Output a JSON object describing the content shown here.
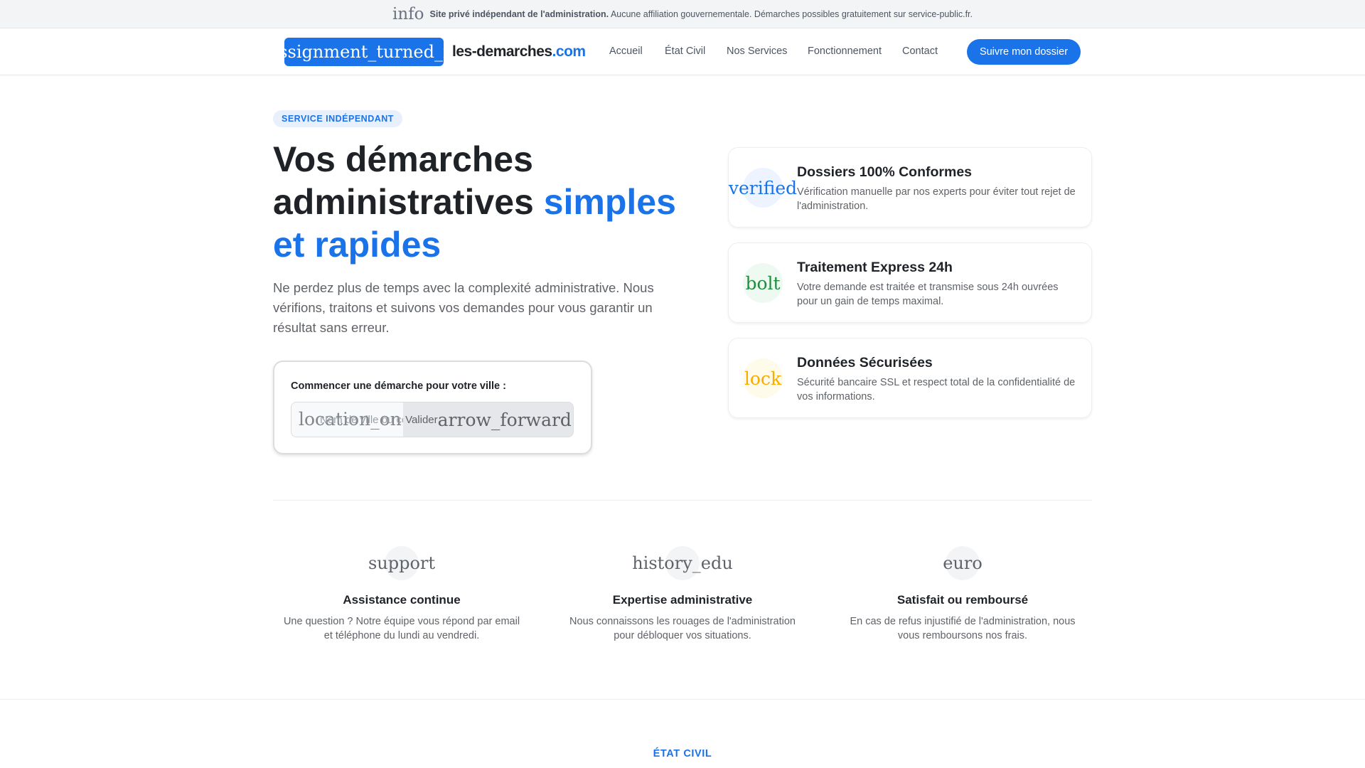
{
  "topbar": {
    "icon": "info",
    "strong": "Site privé indépendant de l'administration.",
    "text": "Aucune affiliation gouvernementale. Démarches possibles gratuitement sur service-public.fr."
  },
  "nav": {
    "logo_icon": "assignment_turned_in",
    "brand_main": "les-demarches",
    "brand_tld": ".com",
    "links": [
      "Accueil",
      "État Civil",
      "Nos Services",
      "Fonctionnement",
      "Contact"
    ],
    "cta": "Suivre mon dossier"
  },
  "hero": {
    "badge": "SERVICE INDÉPENDANT",
    "title_1": "Vos démarches administratives ",
    "title_hl": "simples et rapides",
    "lead": "Ne perdez plus de temps avec la complexité administrative. Nous vérifions, traitons et suivons vos demandes pour vous garantir un résultat sans erreur."
  },
  "search": {
    "label": "Commencer une démarche pour votre ville :",
    "icon": "location_on",
    "placeholder": "Nom de ville ou code postal",
    "button": "Valider",
    "button_icon": "arrow_forward"
  },
  "features": [
    {
      "icon": "verified",
      "title": "Dossiers 100% Conformes",
      "desc": "Vérification manuelle par nos experts pour éviter tout rejet de l'administration.",
      "color": "#1a73e8",
      "bg": "#eef4ff"
    },
    {
      "icon": "bolt",
      "title": "Traitement Express 24h",
      "desc": "Votre demande est traitée et transmise sous 24h ouvrées pour un gain de temps maximal.",
      "color": "#1e8e3e",
      "bg": "#eefaf1"
    },
    {
      "icon": "lock",
      "title": "Données Sécurisées",
      "desc": "Sécurité bancaire SSL et respect total de la confidentialité de vos informations.",
      "color": "#f9ab00",
      "bg": "#fffbea"
    }
  ],
  "values": [
    {
      "icon": "support",
      "title": "Assistance continue",
      "desc": "Une question ? Notre équipe vous répond par email et téléphone du lundi au vendredi."
    },
    {
      "icon": "history_edu",
      "title": "Expertise administrative",
      "desc": "Nous connaissons les rouages de l'administration pour débloquer vos situations."
    },
    {
      "icon": "euro",
      "title": "Satisfait ou remboursé",
      "desc": "En cas de refus injustifié de l'administration, nous vous remboursons nos frais."
    }
  ],
  "section_label": "ÉTAT CIVIL"
}
